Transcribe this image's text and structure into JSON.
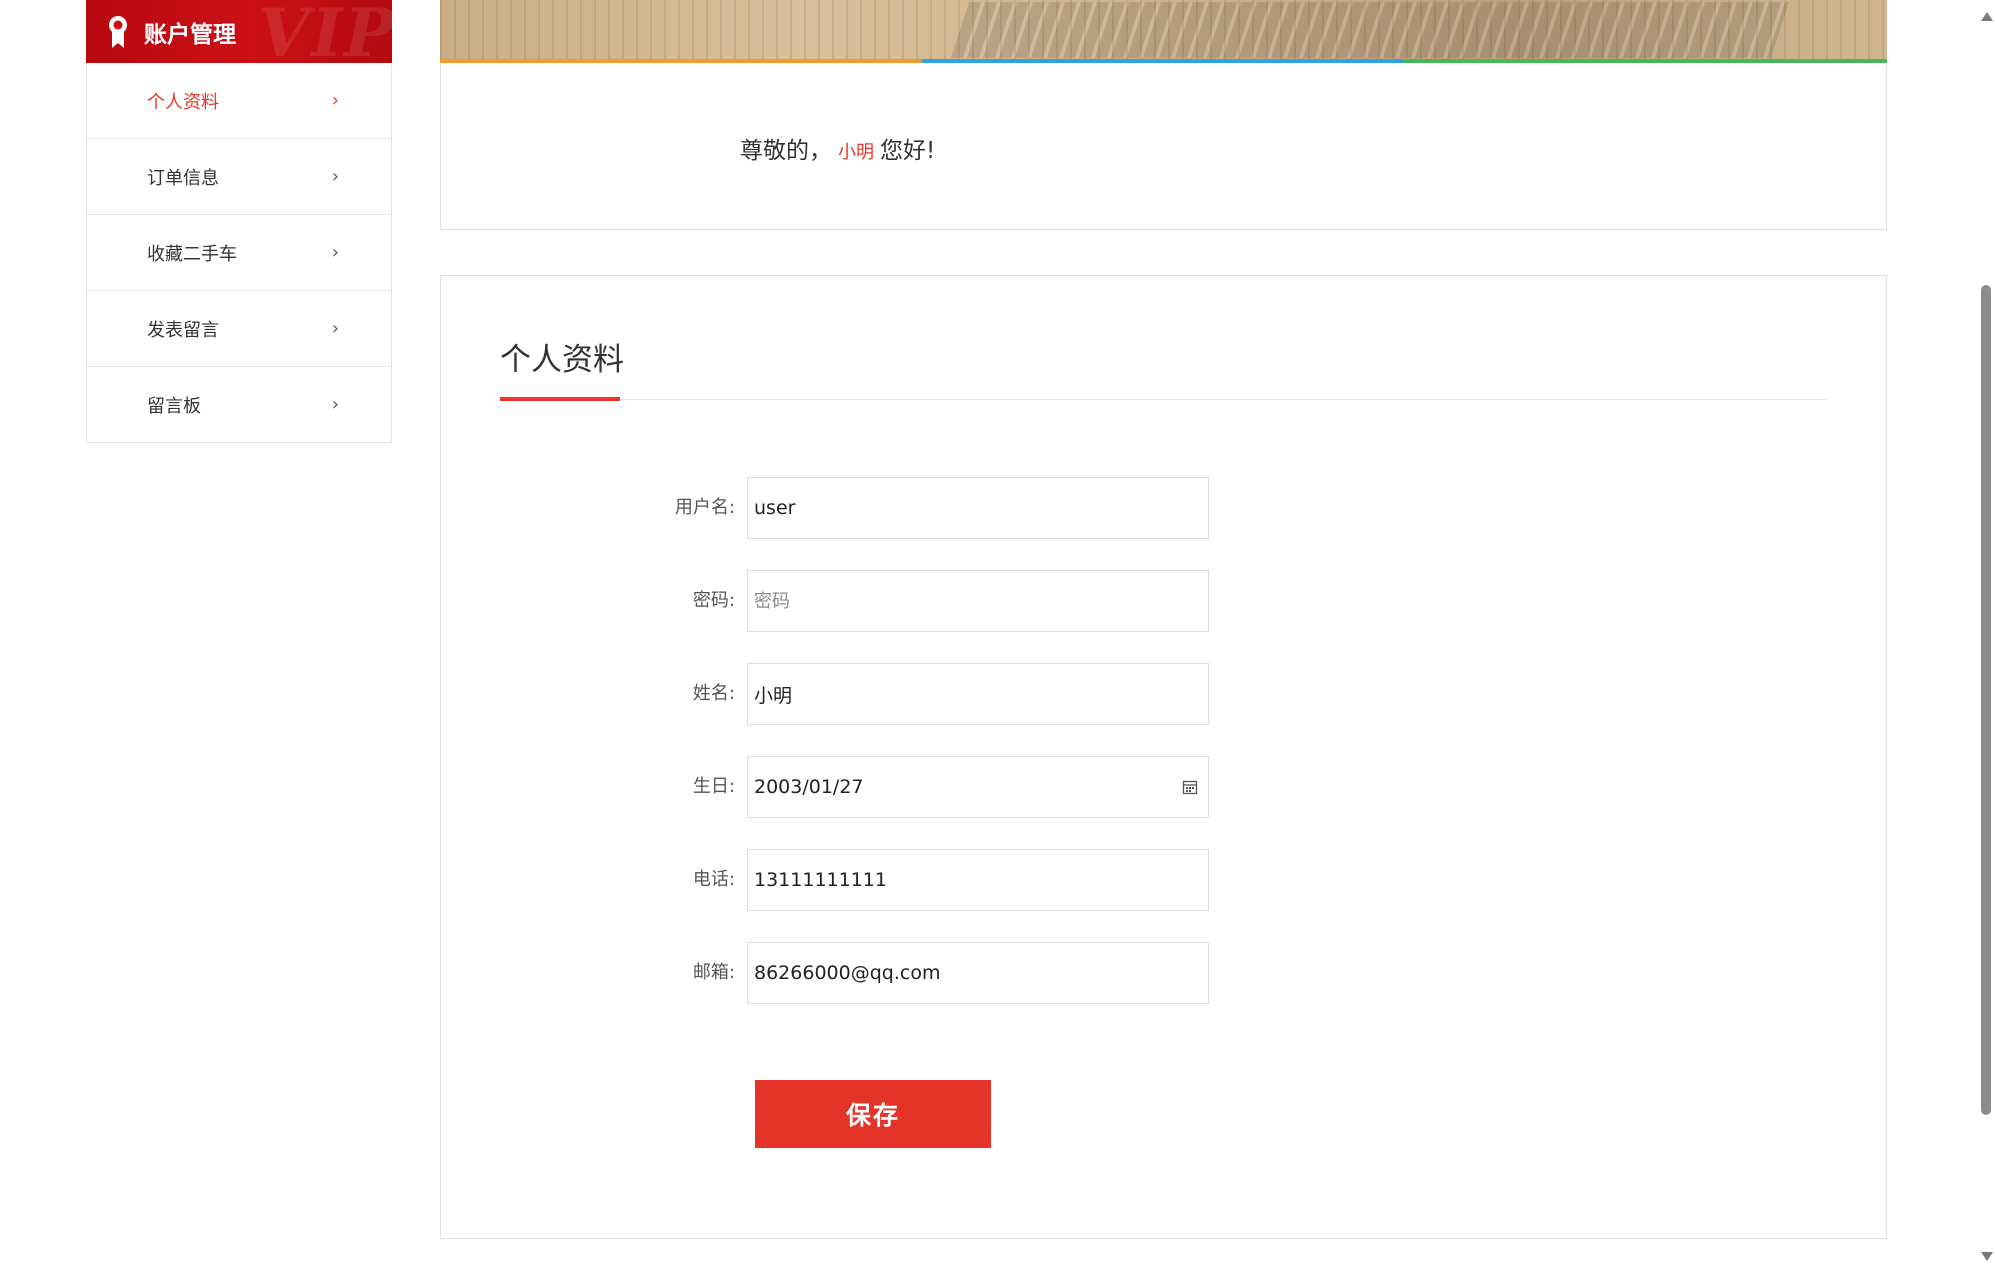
{
  "sidebar": {
    "title": "账户管理",
    "watermark": "VIP",
    "items": [
      {
        "label": "个人资料",
        "active": true
      },
      {
        "label": "订单信息",
        "active": false
      },
      {
        "label": "收藏二手车",
        "active": false
      },
      {
        "label": "发表留言",
        "active": false
      },
      {
        "label": "留言板",
        "active": false
      }
    ],
    "chevron": "›"
  },
  "greeting": {
    "prefix": "尊敬的，",
    "username": "小明",
    "suffix": "您好!"
  },
  "profile": {
    "title": "个人资料",
    "fields": {
      "username": {
        "label": "用户名:",
        "value": "user",
        "placeholder": ""
      },
      "password": {
        "label": "密码:",
        "value": "",
        "placeholder": "密码"
      },
      "name": {
        "label": "姓名:",
        "value": "小明",
        "placeholder": ""
      },
      "birthday": {
        "label": "生日:",
        "value": "2003/01/27",
        "placeholder": ""
      },
      "phone": {
        "label": "电话:",
        "value": "13111111111",
        "placeholder": ""
      },
      "email": {
        "label": "邮箱:",
        "value": "86266000@qq.com",
        "placeholder": ""
      }
    },
    "save_label": "保存"
  },
  "colors": {
    "accent": "#e8372a",
    "sidebar_header": "#cc1116",
    "strip": [
      "#f29b2c",
      "#2ea3e2",
      "#46b85a"
    ]
  },
  "icons": {
    "sidebar_header": "medal-icon",
    "birthday": "calendar-icon",
    "menu": "chevron-right-icon"
  }
}
